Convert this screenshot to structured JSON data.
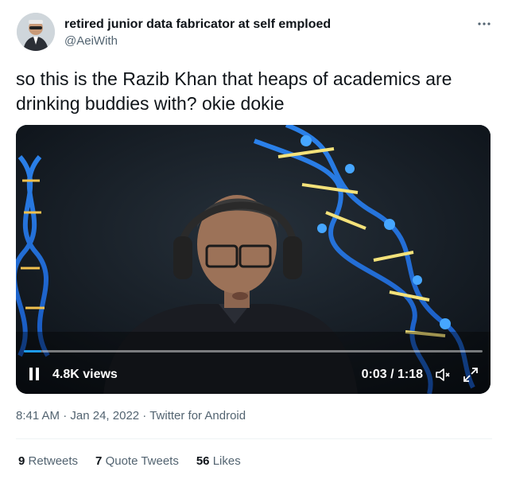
{
  "author": {
    "display_name": "retired junior data fabricator at self emploed",
    "handle": "@AeiWith"
  },
  "tweet": {
    "text": "so this is the Razib Khan that heaps of academics are drinking buddies with? okie dokie"
  },
  "video": {
    "views": "4.8K views",
    "time": "0:03 / 1:18",
    "progress_fraction": 0.038,
    "accent": "#1d9bf0"
  },
  "meta": {
    "time": "8:41 AM",
    "sep1": " · ",
    "date": "Jan 24, 2022",
    "sep2": " · ",
    "source": "Twitter for Android"
  },
  "stats": {
    "retweets_count": "9",
    "retweets_label": "Retweets",
    "quotes_count": "7",
    "quotes_label": "Quote Tweets",
    "likes_count": "56",
    "likes_label": "Likes"
  },
  "icons": {
    "avatar": "user-avatar",
    "more": "more-icon",
    "pause": "pause-icon",
    "mute": "mute-icon",
    "fullscreen": "fullscreen-icon"
  }
}
